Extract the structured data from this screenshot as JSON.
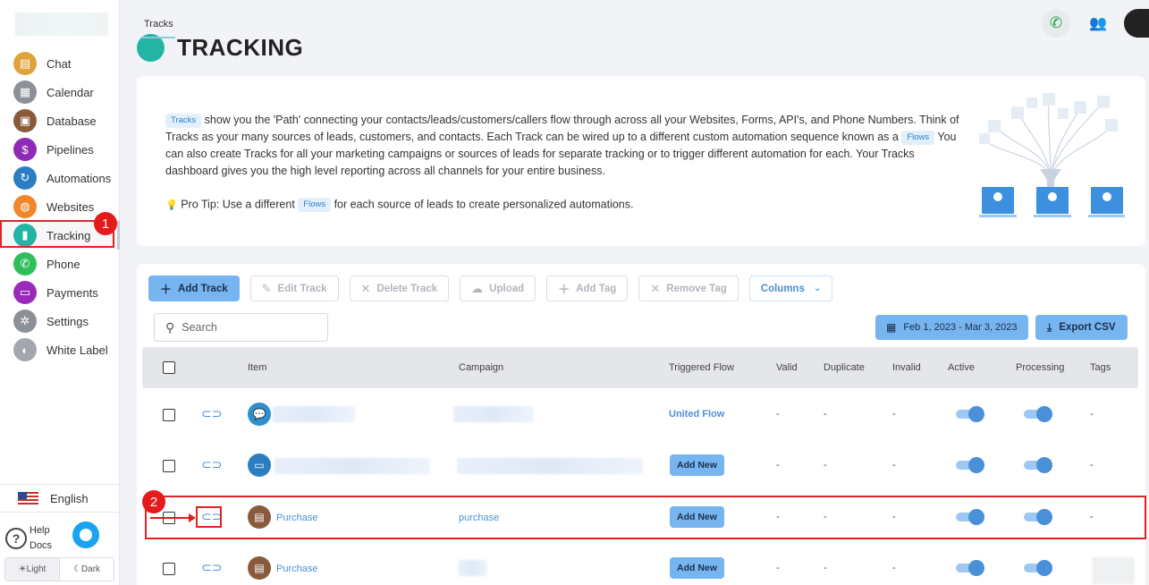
{
  "sidebar": {
    "items": [
      {
        "label": "Chat",
        "icon": "chat-icon",
        "color": "#2f8fd0",
        "glyph": "▤"
      },
      {
        "label": "Calendar",
        "icon": "calendar-icon",
        "color": "#8c9097",
        "glyph": "▦"
      },
      {
        "label": "Database",
        "icon": "database-icon",
        "color": "#8a5a3c",
        "glyph": "▣"
      },
      {
        "label": "Pipelines",
        "icon": "pipelines-icon",
        "color": "#8e2bb8",
        "glyph": "$"
      },
      {
        "label": "Automations",
        "icon": "automations-icon",
        "color": "#2c7dc2",
        "glyph": "↻"
      },
      {
        "label": "Websites",
        "icon": "websites-icon",
        "color": "#f0852a",
        "glyph": "◍"
      },
      {
        "label": "Tracking",
        "icon": "tracking-icon",
        "color": "#22b5a3",
        "glyph": "▮"
      },
      {
        "label": "Phone",
        "icon": "phone-icon",
        "color": "#2fbf5a",
        "glyph": "✆"
      },
      {
        "label": "Payments",
        "icon": "payments-icon",
        "color": "#9a2bb8",
        "glyph": "▭"
      },
      {
        "label": "Settings",
        "icon": "settings-icon",
        "color": "#8c9097",
        "glyph": "✲"
      },
      {
        "label": "White Label",
        "icon": "white-label-icon",
        "color": "#a3a7ad",
        "glyph": "◐"
      }
    ],
    "language": "English",
    "help_line1": "Help",
    "help_line2": "Docs",
    "theme_light": "☀Light",
    "theme_dark": "☾Dark"
  },
  "annotations": {
    "badge1": "1",
    "badge2": "2"
  },
  "header": {
    "breadcrumb": "Tracks",
    "title": "TRACKING"
  },
  "info": {
    "chip_tracks": "Tracks",
    "text1": " show you the 'Path' connecting your contacts/leads/customers/callers flow through across all your Websites, Forms, API's, and Phone Numbers. Think of Tracks as your many sources of leads, customers, and contacts. Each Track can be wired up to a different custom automation sequence known as a ",
    "chip_flows": "Flows",
    "text2": " You can also create Tracks for all your marketing campaigns or sources of leads for separate tracking or to trigger different automation for each. Your Tracks dashboard gives you the high level reporting across all channels for your entire business.",
    "protip_a": "Pro Tip: Use a different ",
    "protip_chip": "Flows",
    "protip_b": " for each source of leads to create personalized automations."
  },
  "toolbar": {
    "add_track": "Add Track",
    "edit_track": "Edit Track",
    "delete_track": "Delete Track",
    "upload": "Upload",
    "add_tag": "Add Tag",
    "remove_tag": "Remove Tag",
    "columns": "Columns",
    "search_placeholder": "Search",
    "date_range": "Feb 1, 2023 - Mar 3, 2023",
    "export_csv": "Export CSV"
  },
  "table": {
    "headers": {
      "item": "Item",
      "campaign": "Campaign",
      "triggered_flow": "Triggered Flow",
      "valid": "Valid",
      "duplicate": "Duplicate",
      "invalid": "Invalid",
      "active": "Active",
      "processing": "Processing",
      "tags": "Tags"
    },
    "rows": [
      {
        "item": "",
        "campaign": "",
        "flow": "United Flow",
        "valid": "-",
        "duplicate": "-",
        "invalid": "-",
        "tags": "-",
        "active": true,
        "processing": true
      },
      {
        "item": "",
        "campaign": "",
        "flow": "Add New",
        "valid": "-",
        "duplicate": "-",
        "invalid": "-",
        "tags": "-",
        "active": true,
        "processing": true
      },
      {
        "item": "Purchase",
        "campaign": "purchase",
        "flow": "Add New",
        "valid": "-",
        "duplicate": "-",
        "invalid": "-",
        "tags": "-",
        "active": true,
        "processing": true
      },
      {
        "item": "Purchase",
        "campaign": "",
        "flow": "Add New",
        "valid": "-",
        "duplicate": "-",
        "invalid": "-",
        "tags": "",
        "active": true,
        "processing": true
      }
    ]
  }
}
